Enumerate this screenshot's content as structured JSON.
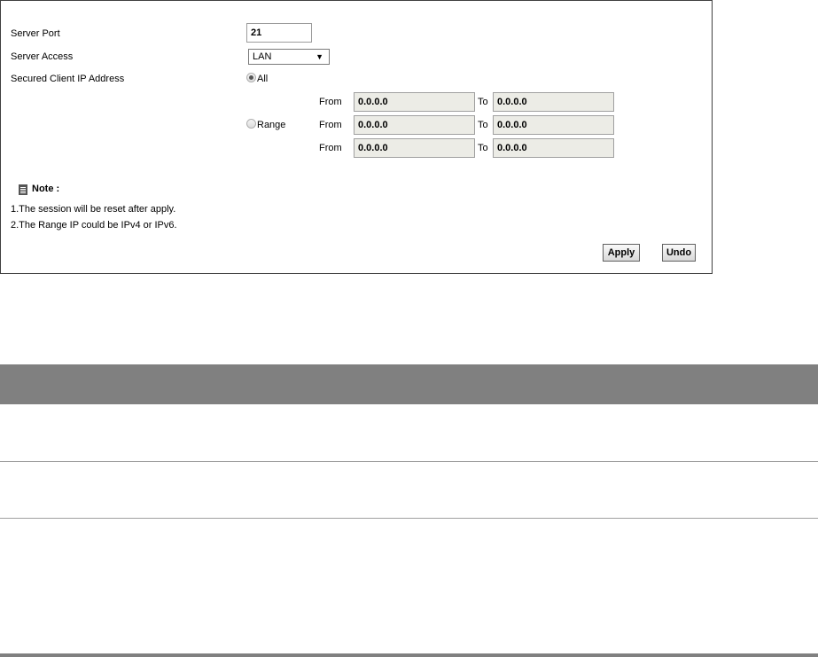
{
  "form": {
    "server_port_label": "Server Port",
    "server_port_value": "21",
    "server_access_label": "Server Access",
    "server_access_selected": "LAN",
    "secured_client_label": "Secured Client IP Address",
    "radio_all_label": "All",
    "radio_range_label": "Range",
    "radio_selected": "All",
    "from_label": "From",
    "to_label": "To",
    "ranges": [
      {
        "from": "0.0.0.0",
        "to": "0.0.0.0"
      },
      {
        "from": "0.0.0.0",
        "to": "0.0.0.0"
      },
      {
        "from": "0.0.0.0",
        "to": "0.0.0.0"
      }
    ]
  },
  "note": {
    "title": "Note :",
    "lines": [
      "1.The session will be reset after apply.",
      "2.The Range IP could be IPv4 or IPv6."
    ]
  },
  "buttons": {
    "apply": "Apply",
    "undo": "Undo"
  },
  "icons": {
    "note": "note-icon",
    "dropdown": "chevron-down-icon"
  }
}
